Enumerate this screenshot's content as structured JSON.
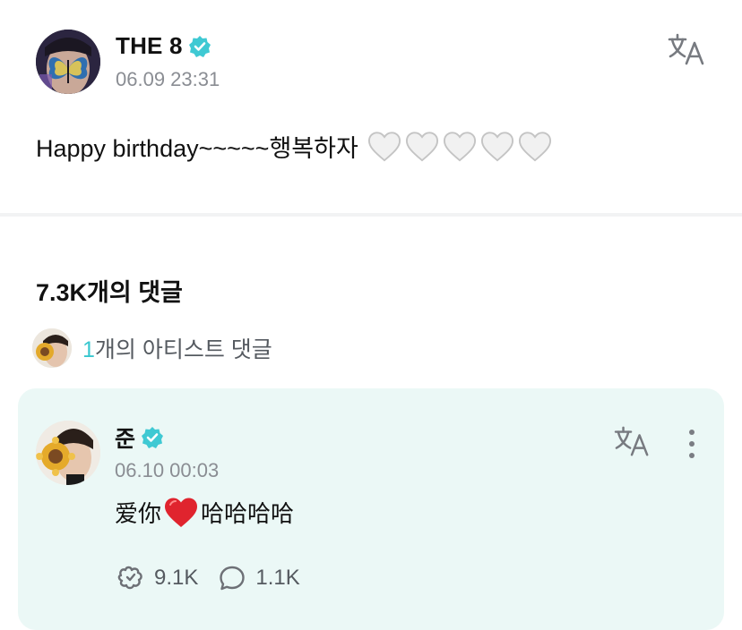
{
  "post": {
    "author": "THE 8",
    "timestamp": "06.09 23:31",
    "text": "Happy birthday~~~~~행복하자",
    "heart_count": 5,
    "translate_icon": "translate-icon"
  },
  "comments": {
    "title": "7.3K개의 댓글",
    "artist_count": "1",
    "artist_label": "개의 아티스트 댓글"
  },
  "comment": {
    "author": "준",
    "timestamp": "06.10 00:03",
    "text_before": "爱你",
    "text_after": "哈哈哈哈",
    "likes": "9.1K",
    "replies": "1.1K"
  },
  "colors": {
    "accent": "#38c7cf",
    "card_bg": "#ebf8f6",
    "heart_red": "#e0242e"
  }
}
